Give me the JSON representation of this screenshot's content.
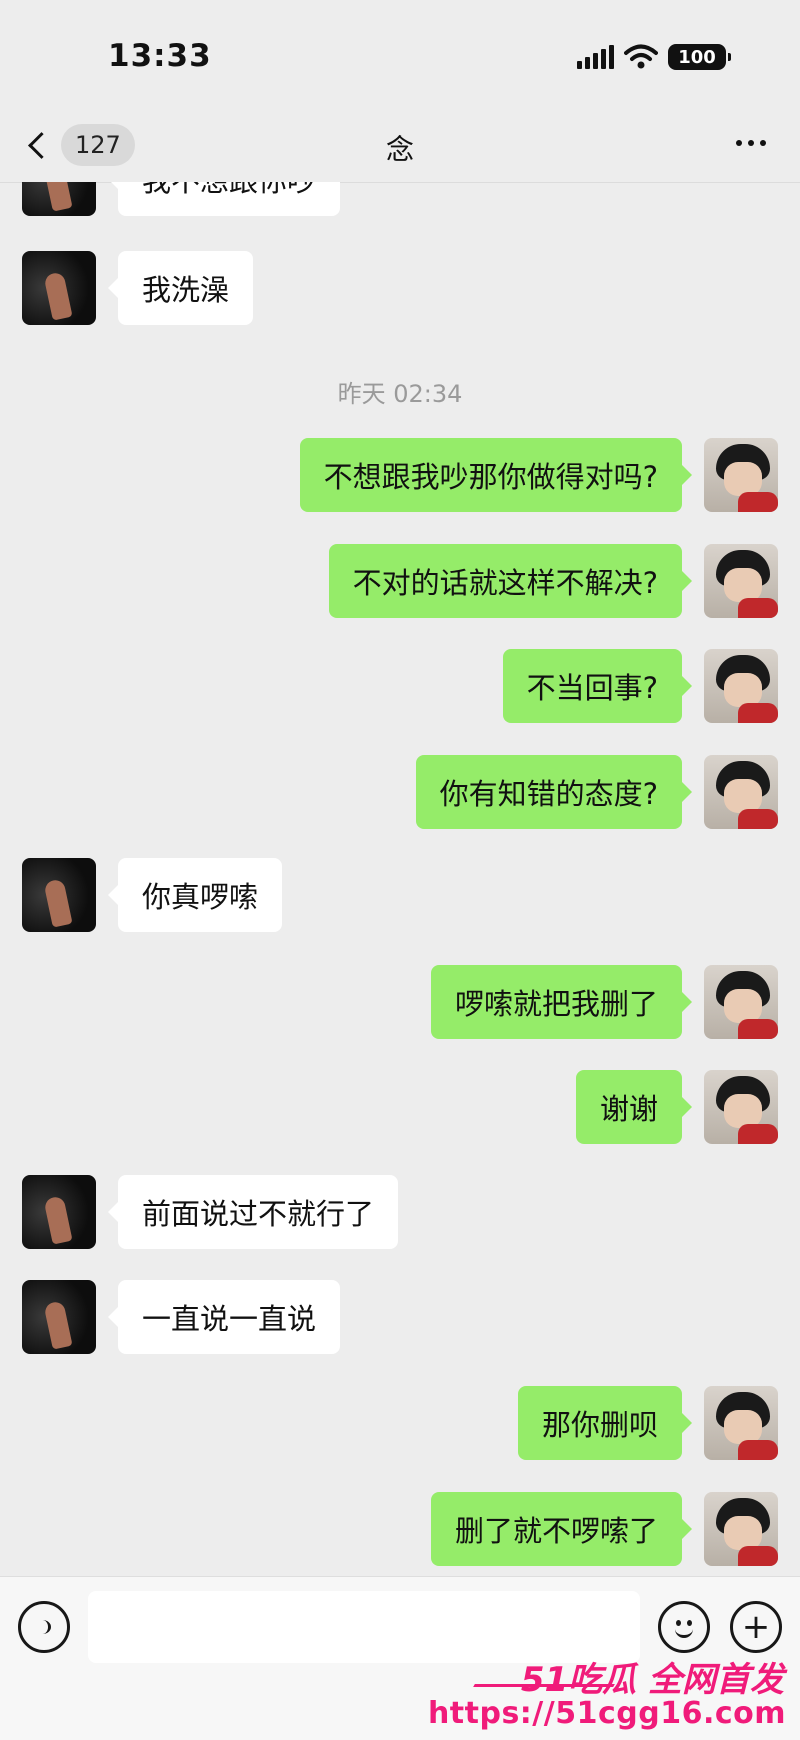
{
  "status_bar": {
    "time": "13:33",
    "battery": "100"
  },
  "nav": {
    "unread_count": "127",
    "title": "念"
  },
  "chat": {
    "cutoff_message": "我不想跟你吵",
    "messages": [
      {
        "from": "them",
        "text": "我洗澡"
      },
      {
        "timestamp": "昨天 02:34"
      },
      {
        "from": "me",
        "text": "不想跟我吵那你做得对吗?"
      },
      {
        "from": "me",
        "text": "不对的话就这样不解决?"
      },
      {
        "from": "me",
        "text": "不当回事?"
      },
      {
        "from": "me",
        "text": "你有知错的态度?"
      },
      {
        "from": "them",
        "text": "你真啰嗦"
      },
      {
        "from": "me",
        "text": "啰嗦就把我删了"
      },
      {
        "from": "me",
        "text": "谢谢"
      },
      {
        "from": "them",
        "text": "前面说过不就行了"
      },
      {
        "from": "them",
        "text": "一直说一直说"
      },
      {
        "from": "me",
        "text": "那你删呗"
      },
      {
        "from": "me",
        "text": "删了就不啰嗦了"
      }
    ]
  },
  "watermark": {
    "line1": "51吃瓜 全网首发",
    "line2": "https://51cgg16.com"
  },
  "colors": {
    "background": "#ededed",
    "bubble_me": "#95ec69",
    "bubble_them": "#ffffff",
    "watermark": "#f01b7a"
  },
  "icons": [
    "signal-icon",
    "wifi-icon",
    "battery-icon",
    "back-chevron-icon",
    "more-dots-icon",
    "voice-icon",
    "emoji-icon",
    "plus-icon"
  ]
}
